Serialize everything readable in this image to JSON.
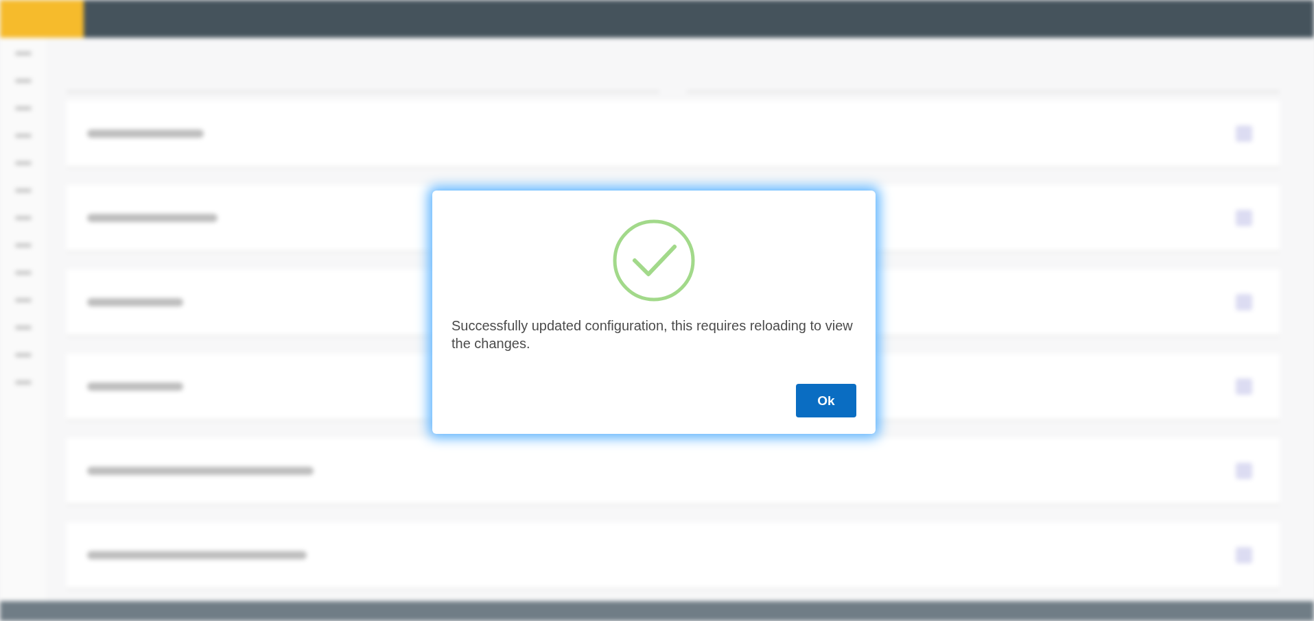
{
  "dialog": {
    "message": "Successfully updated configuration, this requires reloading to view the changes.",
    "button": "Ok"
  }
}
